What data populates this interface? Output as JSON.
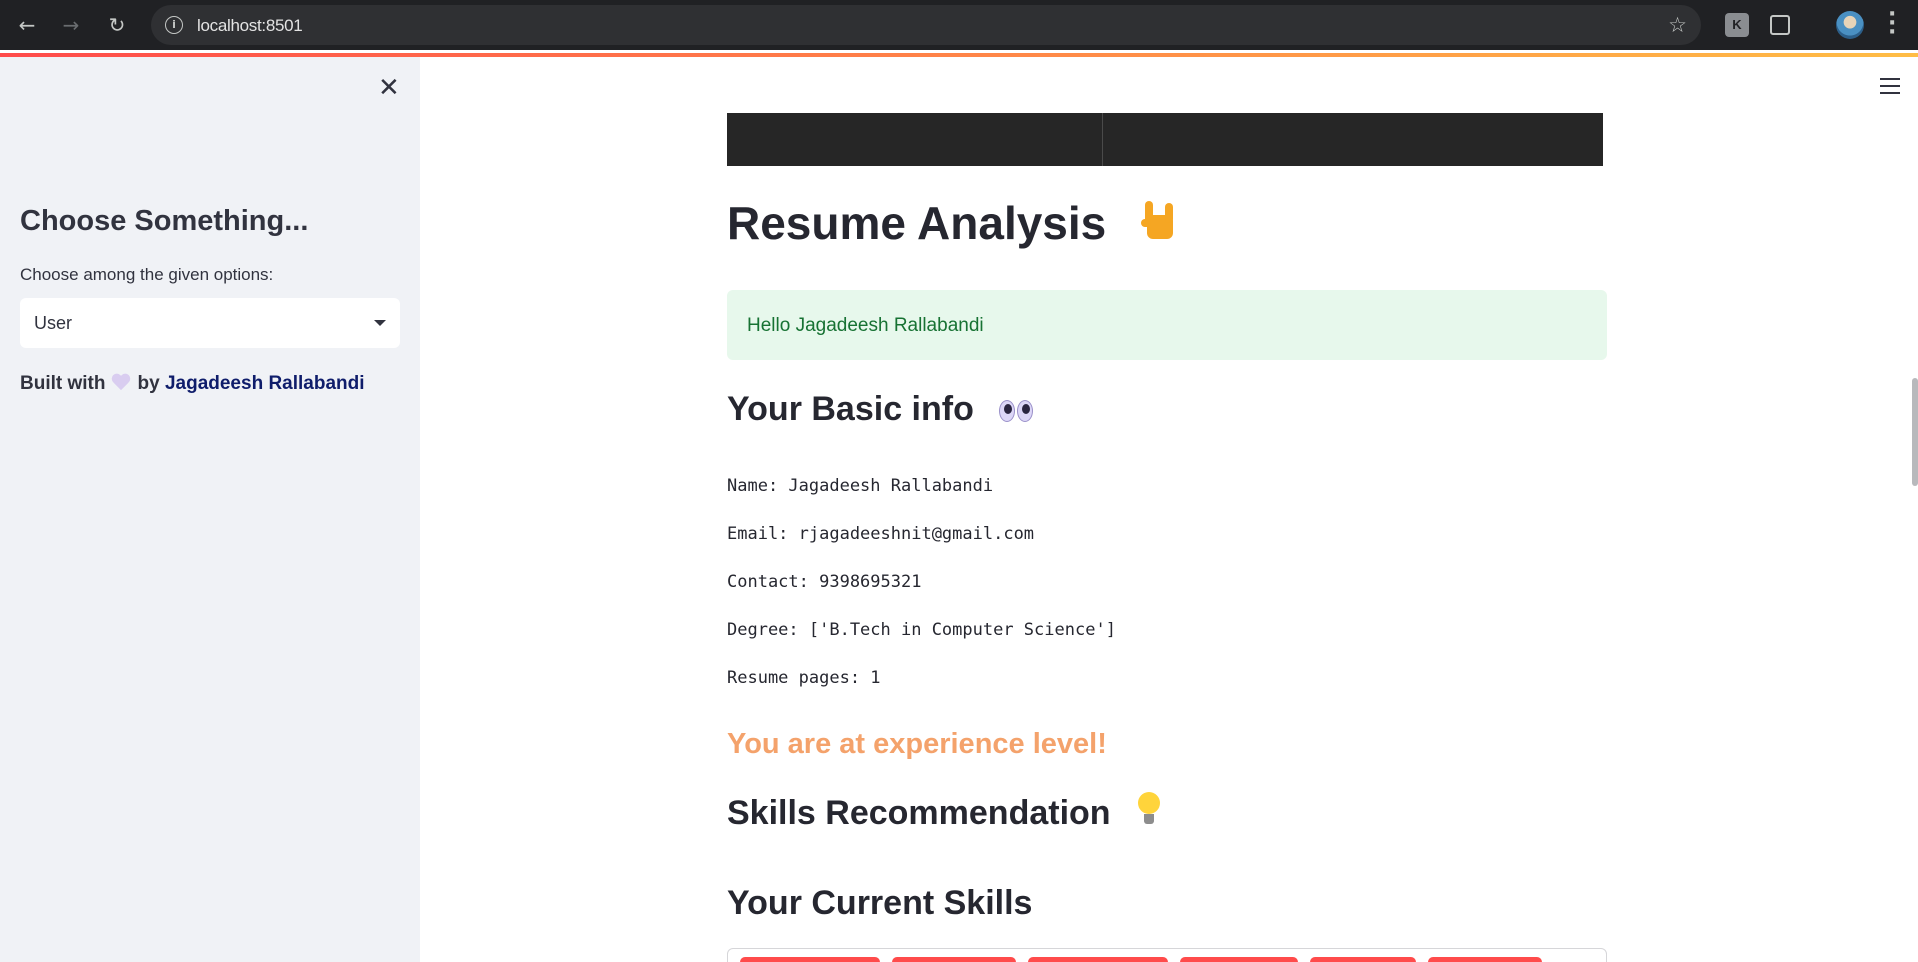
{
  "browser": {
    "url": "localhost:8501"
  },
  "sidebar": {
    "title": "Choose Something...",
    "select_label": "Choose among the given options:",
    "select_value": "User",
    "built_prefix": "Built with",
    "built_by": "by",
    "author": "Jagadeesh Rallabandi"
  },
  "main": {
    "title": "Resume Analysis",
    "greeting": "Hello Jagadeesh Rallabandi",
    "basic_info_heading": "Your Basic info",
    "info": {
      "name": "Name: Jagadeesh Rallabandi",
      "email": "Email: rjagadeeshnit@gmail.com",
      "contact": "Contact: 9398695321",
      "degree": "Degree: ['B.Tech in Computer Science']",
      "pages": "Resume pages: 1"
    },
    "experience": "You are at experience level!",
    "skills_heading": "Skills Recommendation",
    "current_skills_heading": "Your Current Skills"
  },
  "colors": {
    "accent": "#ff4b4b",
    "success_bg": "#e7f8ec",
    "success_text": "#177233",
    "experience_text": "#f4a26b",
    "sidebar_bg": "#f0f2f6"
  }
}
